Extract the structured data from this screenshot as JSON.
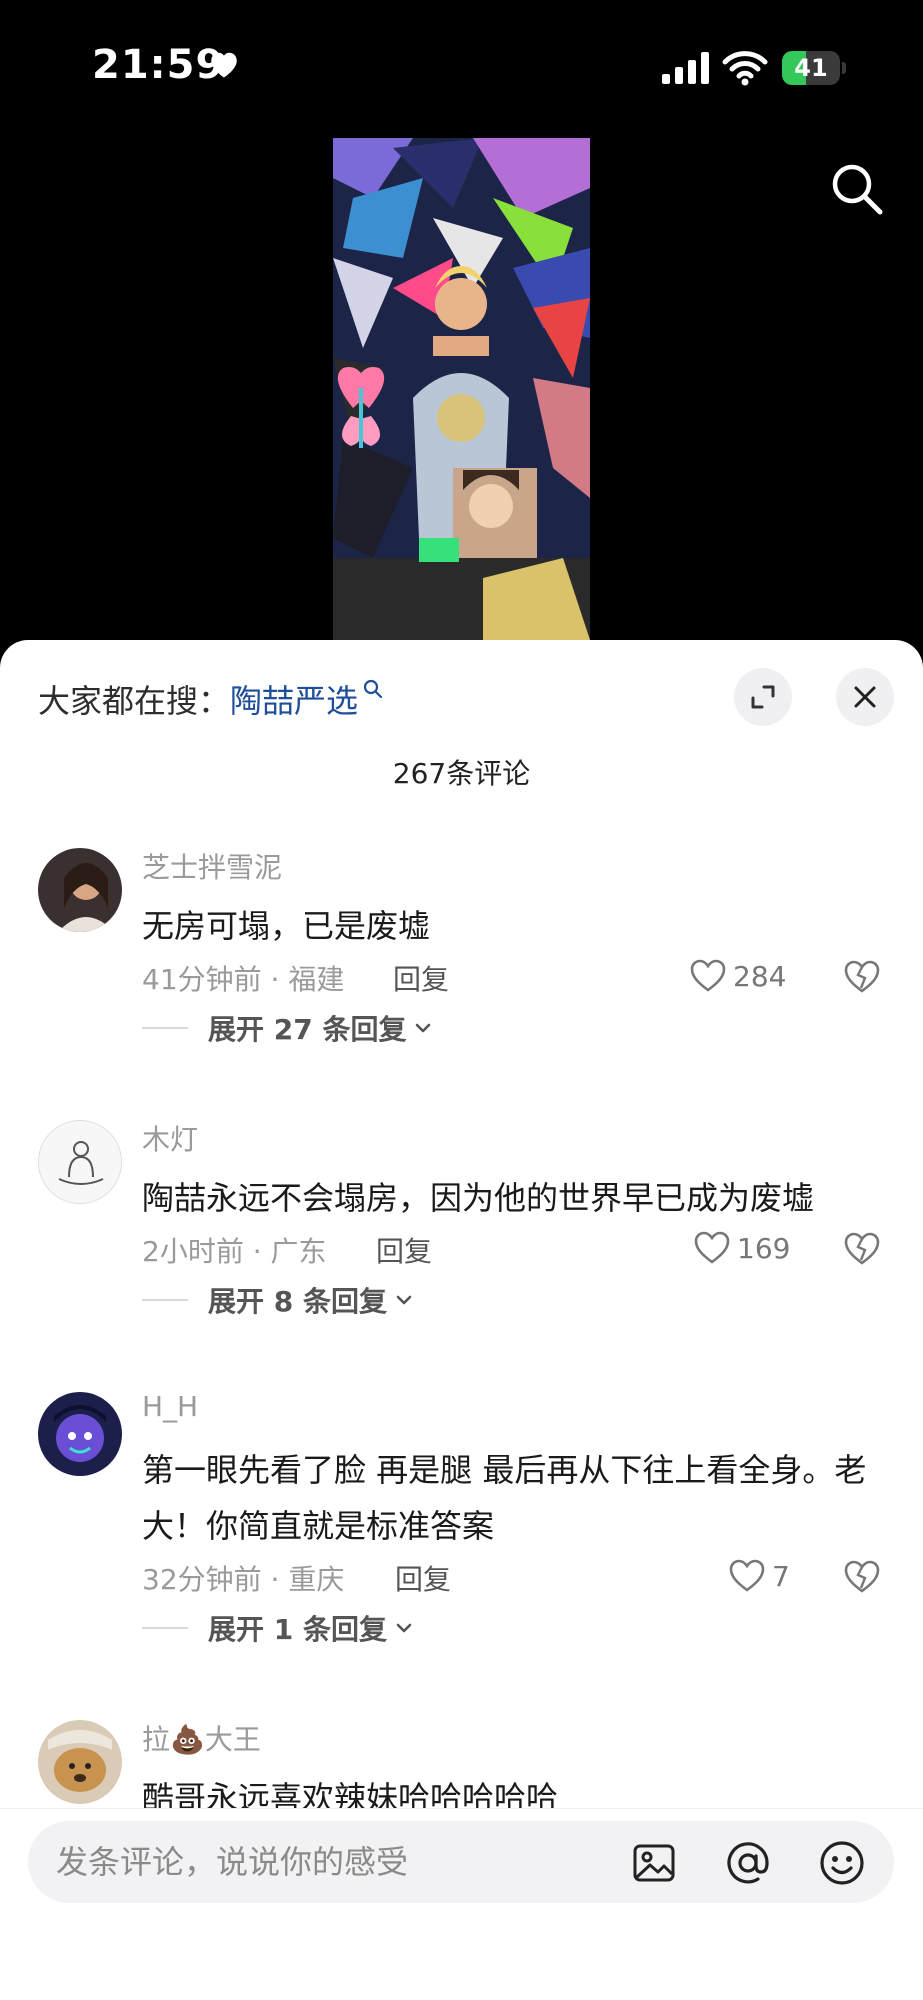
{
  "status_bar": {
    "time": "21:59",
    "battery_level": "41"
  },
  "sheet": {
    "trending_label": "大家都在搜：",
    "trending_term": "陶喆严选",
    "comment_count": "267条评论"
  },
  "comments": [
    {
      "username": "芝士拌雪泥",
      "text": "无房可塌，已是废墟",
      "meta": "41分钟前 · 福建",
      "reply": "回复",
      "likes": "284",
      "expand": "展开 27 条回复"
    },
    {
      "username": "木灯",
      "text": "陶喆永远不会塌房，因为他的世界早已成为废墟",
      "meta": "2小时前 · 广东",
      "reply": "回复",
      "likes": "169",
      "expand": "展开 8 条回复"
    },
    {
      "username": "H_H",
      "text": "第一眼先看了脸 再是腿 最后再从下往上看全身。老大！你简直就是标准答案",
      "meta": "32分钟前 · 重庆",
      "reply": "回复",
      "likes": "7",
      "expand": "展开 1 条回复"
    },
    {
      "username": "拉💩大王",
      "text": "酷哥永远喜欢辣妹哈哈哈哈哈"
    }
  ],
  "input": {
    "placeholder": "发条评论，说说你的感受"
  },
  "icons": {
    "status": [
      "heart-icon",
      "signal-icon",
      "wifi-icon",
      "battery-icon"
    ],
    "top": "search-icon",
    "sheet": [
      "expand-icon",
      "close-icon"
    ],
    "comment": [
      "like-heart-icon",
      "dislike-icon",
      "chevron-down-icon"
    ],
    "input": [
      "image-icon",
      "at-icon",
      "emoji-icon"
    ]
  },
  "colors": {
    "accent_link": "#1f4e9a",
    "battery_green": "#34c759"
  }
}
